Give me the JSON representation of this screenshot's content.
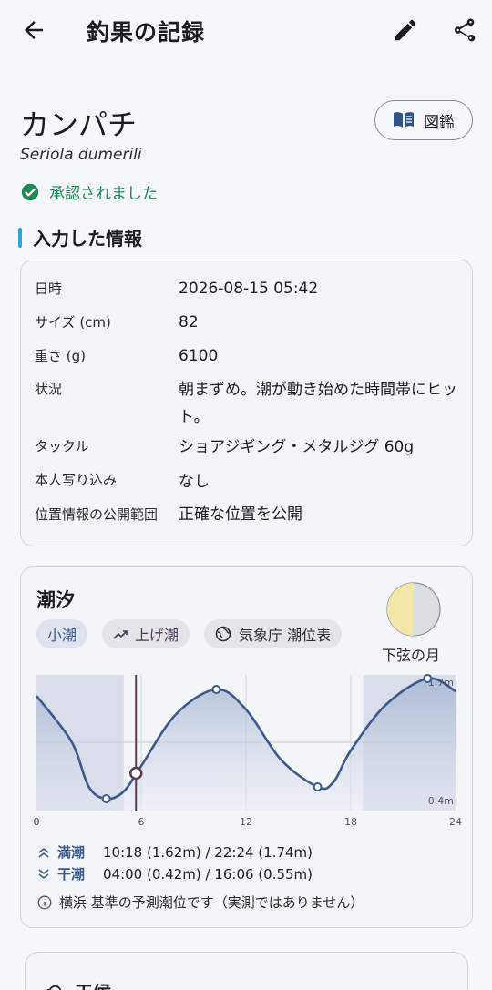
{
  "appbar": {
    "title": "釣果の記録",
    "back_icon": "arrow-left-icon",
    "edit_icon": "pencil-icon",
    "share_icon": "share-icon"
  },
  "species": {
    "name": "カンパチ",
    "scientific": "Seriola dumerili",
    "status": "承認されました",
    "status_color": "#1b8a55"
  },
  "zukan_button": {
    "label": "図鑑",
    "icon": "book-icon"
  },
  "section_input": {
    "title": "入力した情報",
    "accent": "#2aa7d8"
  },
  "info": [
    {
      "key": "日時",
      "value": "2026-08-15 05:42"
    },
    {
      "key": "サイズ (cm)",
      "value": "82"
    },
    {
      "key": "重さ (g)",
      "value": "6100"
    },
    {
      "key": "状況",
      "value": "朝まずめ。潮が動き始めた時間帯にヒット。"
    },
    {
      "key": "タックル",
      "value": "ショアジギング・メタルジグ 60g"
    },
    {
      "key": "本人写り込み",
      "value": "なし"
    },
    {
      "key": "位置情報の公開範囲",
      "value": "正確な位置を公開"
    }
  ],
  "tide": {
    "title": "潮汐",
    "chips": {
      "tide_type": "小潮",
      "trend": "上げ潮",
      "source": "気象庁 潮位表"
    },
    "moon_label": "下弦の月",
    "high_label": "満潮",
    "high_values": "10:18 (1.62m) / 22:24 (1.74m)",
    "low_label": "干潮",
    "low_values": "04:00 (0.42m) / 16:06 (0.55m)",
    "note": "横浜 基準の予測潮位です（実測ではありません）",
    "accent": "#3b5a8c"
  },
  "chart_data": {
    "type": "area",
    "x_ticks": [
      "0",
      "6",
      "12",
      "18",
      "24"
    ],
    "y_ticks": [
      "1.7m",
      "0.4m"
    ],
    "x_range": [
      0,
      24
    ],
    "series": [
      {
        "x": [
          0,
          2,
          3,
          4,
          5,
          6,
          8,
          10.3,
          12,
          14,
          16.1,
          17,
          18,
          20,
          22.4,
          24
        ],
        "y": [
          1.55,
          1.05,
          0.55,
          0.42,
          0.5,
          0.78,
          1.35,
          1.62,
          1.4,
          0.85,
          0.55,
          0.6,
          0.95,
          1.45,
          1.74,
          1.6
        ]
      }
    ],
    "highlights": {
      "current_time": 5.7,
      "night_ranges": [
        [
          0,
          5
        ],
        [
          18.7,
          24
        ]
      ]
    }
  },
  "weather": {
    "title": "天候",
    "icon": "cloud-icon"
  }
}
